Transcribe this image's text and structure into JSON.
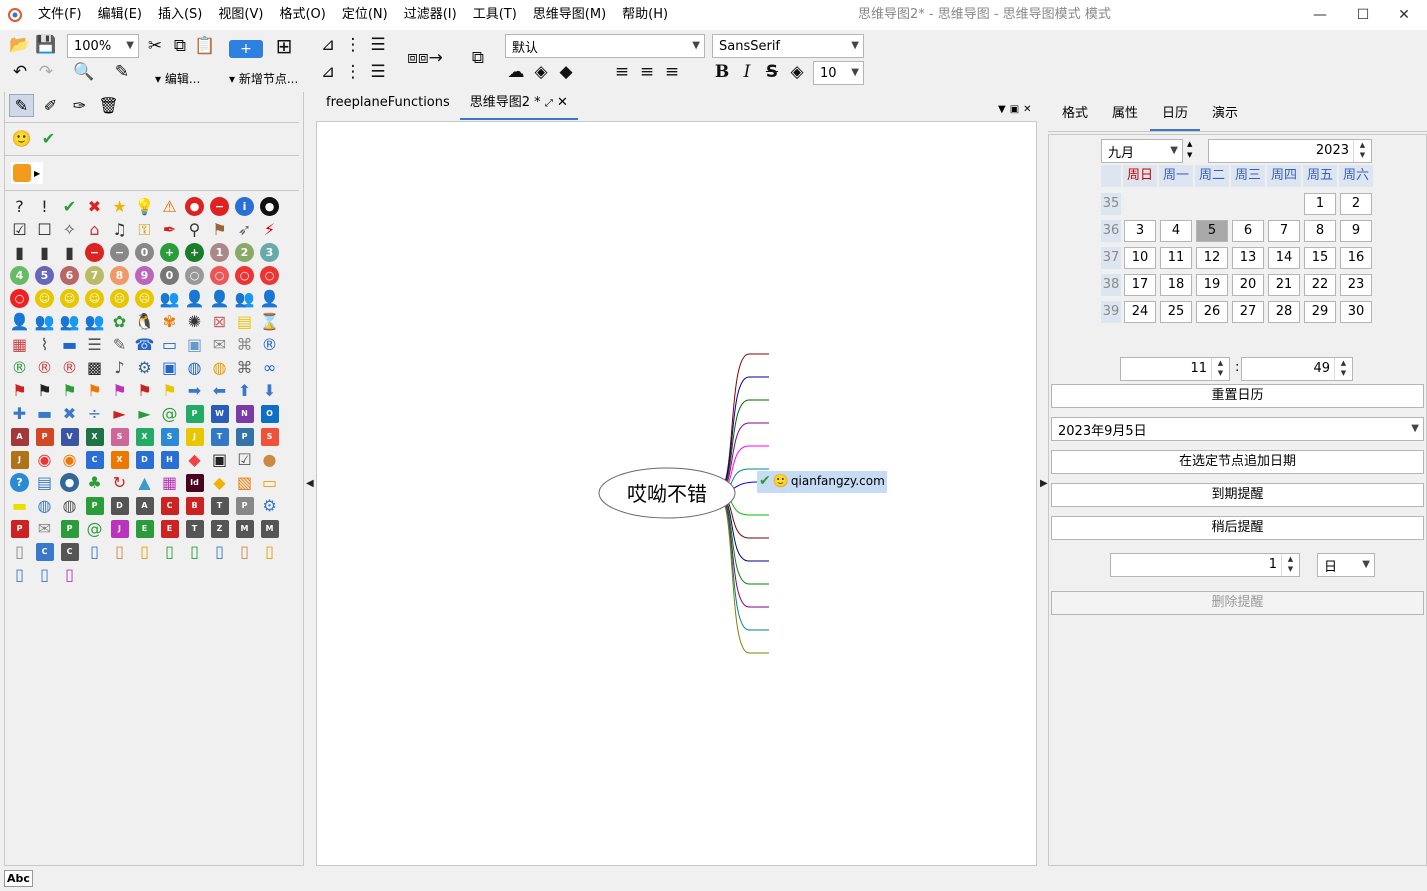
{
  "window": {
    "title": "思维导图2* - 思维导图 - 思维导图模式 模式"
  },
  "menu": [
    "文件(F)",
    "编辑(E)",
    "插入(S)",
    "视图(V)",
    "格式(O)",
    "定位(N)",
    "过滤器(I)",
    "工具(T)",
    "思维导图(M)",
    "帮助(H)"
  ],
  "toolbar": {
    "zoom": "100%",
    "edit_label": "▾ 编辑...",
    "new_node_label": "▾ 新增节点...",
    "style": "默认",
    "font": "SansSerif",
    "font_size": "10"
  },
  "tabs": [
    "freeplaneFunctions",
    "思维导图2 *"
  ],
  "map": {
    "root": "哎呦不错",
    "child": "qianfangzy.com"
  },
  "right_tabs": [
    "格式",
    "属性",
    "日历",
    "演示"
  ],
  "calendar": {
    "month": "九月",
    "year": "2023",
    "weekdays": [
      "周日",
      "周一",
      "周二",
      "周三",
      "周四",
      "周五",
      "周六"
    ],
    "weeks": [
      {
        "no": "35",
        "days": [
          "",
          "",
          "",
          "",
          "",
          "1",
          "2"
        ]
      },
      {
        "no": "36",
        "days": [
          "3",
          "4",
          "5",
          "6",
          "7",
          "8",
          "9"
        ]
      },
      {
        "no": "37",
        "days": [
          "10",
          "11",
          "12",
          "13",
          "14",
          "15",
          "16"
        ]
      },
      {
        "no": "38",
        "days": [
          "17",
          "18",
          "19",
          "20",
          "21",
          "22",
          "23"
        ]
      },
      {
        "no": "39",
        "days": [
          "24",
          "25",
          "26",
          "27",
          "28",
          "29",
          "30"
        ]
      }
    ],
    "selected_day": "5",
    "hour": "11",
    "minute": "49",
    "reset_label": "重置日历",
    "date_value": "2023年9月5日",
    "append_date_label": "在选定节点追加日期",
    "remind_label": "到期提醒",
    "later_label": "稍后提醒",
    "later_amount": "1",
    "later_unit": "日",
    "delete_label": "删除提醒"
  },
  "status": {
    "abc": "Abc"
  }
}
